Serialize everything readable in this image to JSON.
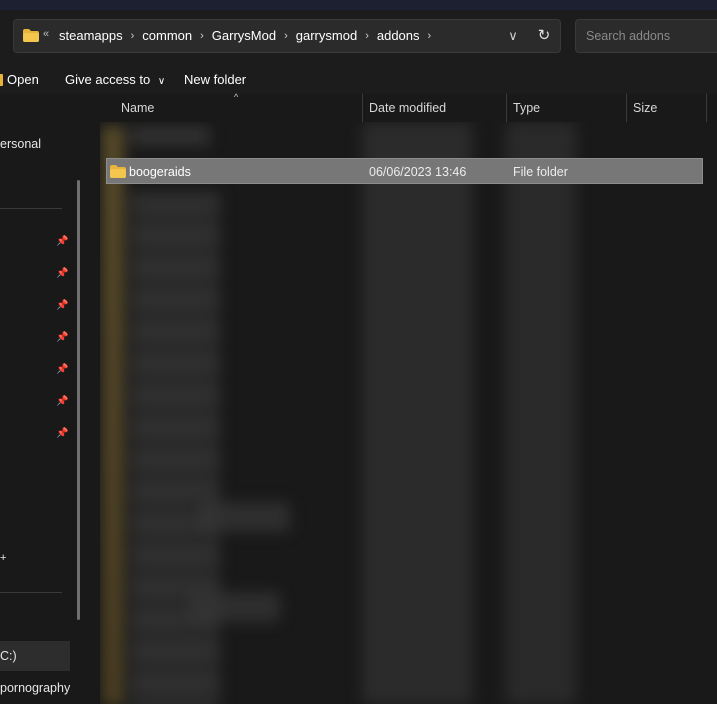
{
  "address_bar": {
    "overflow_glyph": "«",
    "crumbs": [
      "steamapps",
      "common",
      "GarrysMod",
      "garrysmod",
      "addons"
    ],
    "separator_glyph": "›",
    "dropdown_glyph": "∨",
    "refresh_glyph": "↻"
  },
  "search": {
    "placeholder": "Search addons"
  },
  "command_bar": {
    "open_label": "Open",
    "give_access_label": "Give access to",
    "give_access_chevron": "∨",
    "new_folder_label": "New folder"
  },
  "columns": {
    "name": "Name",
    "date_modified": "Date modified",
    "type": "Type",
    "size": "Size",
    "sort_indicator": "^"
  },
  "sidebar": {
    "personal_fragment": "ersonal",
    "plus_glyph": "+",
    "drive_fragment": "C:)",
    "folder_fragment": "pornography",
    "pin_glyph": "📌"
  },
  "file_list": {
    "selected_row": {
      "name": "boogeraids",
      "date_modified": "06/06/2023 13:46",
      "type": "File folder",
      "size": ""
    }
  },
  "colors": {
    "background": "#191919",
    "selected_row": "#777777",
    "folder_yellow": "#e8b33a"
  }
}
